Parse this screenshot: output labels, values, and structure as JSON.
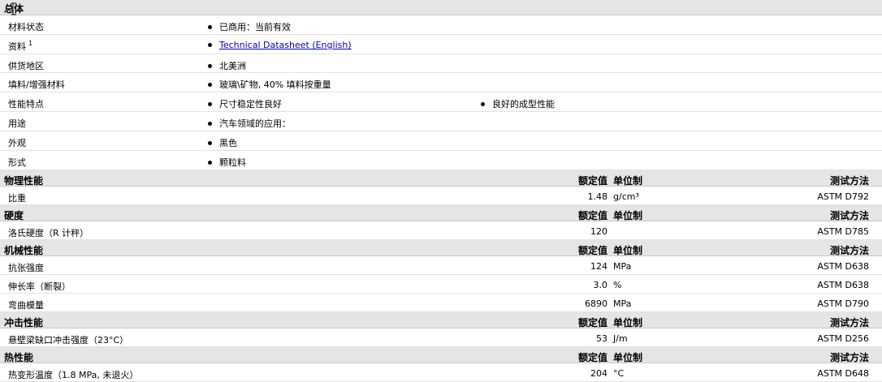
{
  "general": {
    "title": "总体",
    "rows": [
      {
        "label": "材料状态",
        "sup": "",
        "bullets": [
          "已商用：当前有效"
        ]
      },
      {
        "label": "资料",
        "sup": "1",
        "bullets": [
          "Technical Datasheet (English)"
        ],
        "link": true
      },
      {
        "label": "供货地区",
        "sup": "",
        "bullets": [
          "北美洲"
        ]
      },
      {
        "label": "填料/增强材料",
        "sup": "",
        "bullets": [
          "玻璃\\矿物, 40% 填料按重量"
        ]
      },
      {
        "label": "性能特点",
        "sup": "",
        "bullets": [
          "尺寸稳定性良好",
          "良好的成型性能"
        ]
      },
      {
        "label": "用途",
        "sup": "",
        "bullets": [
          "汽车领域的应用："
        ]
      },
      {
        "label": "外观",
        "sup": "",
        "bullets": [
          "黑色"
        ]
      },
      {
        "label": "形式",
        "sup": "",
        "bullets": [
          "颗粒料"
        ]
      }
    ]
  },
  "columns": {
    "value": "额定值",
    "unit": "单位制",
    "method": "测试方法"
  },
  "sections": [
    {
      "title": "物理性能",
      "rows": [
        {
          "label": "比重",
          "value": "1.48",
          "unit": "g/cm³",
          "method": "ASTM D792"
        }
      ]
    },
    {
      "title": "硬度",
      "rows": [
        {
          "label": "洛氏硬度（R 计秤）",
          "value": "120",
          "unit": "",
          "method": "ASTM D785"
        }
      ]
    },
    {
      "title": "机械性能",
      "rows": [
        {
          "label": "抗张强度",
          "value": "124",
          "unit": "MPa",
          "method": "ASTM D638"
        },
        {
          "label": "伸长率（断裂）",
          "value": "3.0",
          "unit": "%",
          "method": "ASTM D638"
        },
        {
          "label": "弯曲模量",
          "value": "6890",
          "unit": "MPa",
          "method": "ASTM D790"
        }
      ]
    },
    {
      "title": "冲击性能",
      "rows": [
        {
          "label": "悬壁梁缺口冲击强度（23°C）",
          "value": "53",
          "unit": "J/m",
          "method": "ASTM D256"
        }
      ]
    },
    {
      "title": "热性能",
      "rows": [
        {
          "label": "热变形温度（1.8 MPa, 未退火）",
          "value": "204",
          "unit": "°C",
          "method": "ASTM D648"
        }
      ]
    }
  ]
}
